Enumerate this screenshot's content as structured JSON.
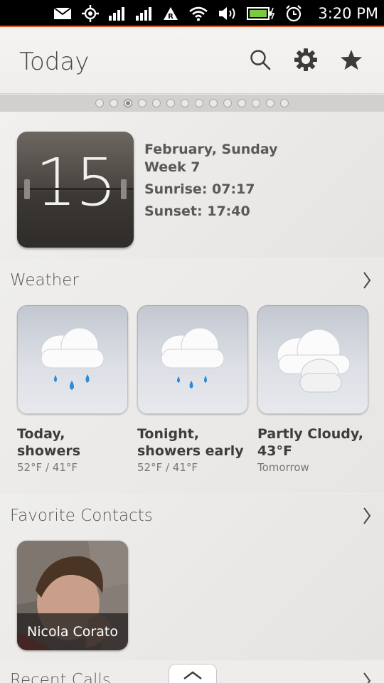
{
  "status_bar": {
    "time": "3:20 PM",
    "icons": [
      "mail-icon",
      "gps-icon",
      "signal-icon",
      "signal-icon",
      "roaming-icon",
      "wifi-icon",
      "volume-icon",
      "battery-charging-icon",
      "alarm-icon"
    ]
  },
  "header": {
    "title": "Today",
    "actions": [
      "search-icon",
      "gear-icon",
      "star-icon"
    ]
  },
  "pager": {
    "count": 14,
    "active_index": 2
  },
  "date": {
    "day_number": "15",
    "month_weekday": "February, Sunday",
    "week": "Week 7",
    "sunrise": "Sunrise: 07:17",
    "sunset": "Sunset: 17:40"
  },
  "weather": {
    "label": "Weather",
    "cards": [
      {
        "name": "Today, showers",
        "temp": "52°F / 41°F",
        "icon": "rain-cloud-icon"
      },
      {
        "name": "Tonight, showers early",
        "temp": "52°F / 41°F",
        "icon": "rain-cloud-icon"
      },
      {
        "name": "Partly Cloudy, 43°F",
        "temp": "Tomorrow",
        "icon": "cloud-icon"
      }
    ]
  },
  "contacts": {
    "label": "Favorite Contacts",
    "items": [
      {
        "name": "Nicola Corato"
      }
    ]
  },
  "recent_calls": {
    "label": "Recent Calls"
  },
  "colors": {
    "accent": "#e2582d",
    "background": "#ecebea",
    "status_bar": "#000000"
  }
}
